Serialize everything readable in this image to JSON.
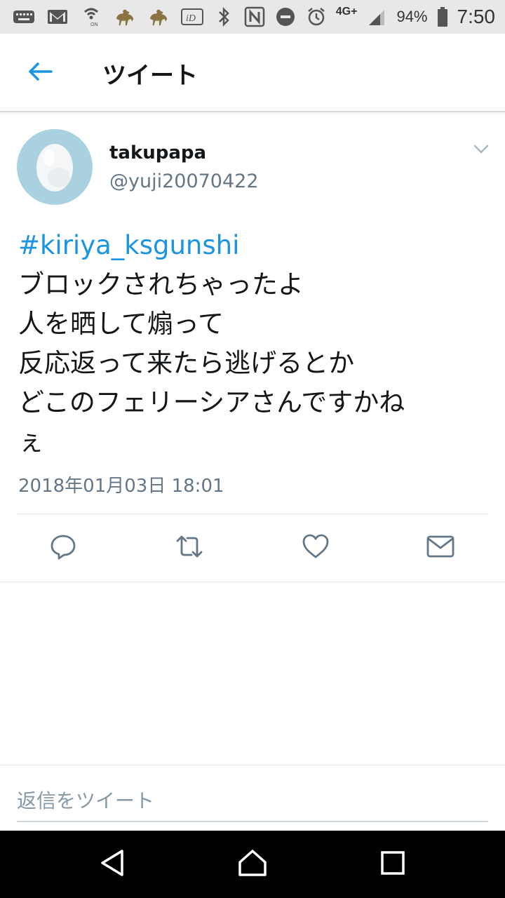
{
  "status_bar": {
    "icons_left": [
      "keyboard-icon",
      "gmail-icon",
      "wifi-calling-icon",
      "horse-racing-icon",
      "horse-racing-icon",
      "id-icon"
    ],
    "icons_right": [
      "bluetooth-icon",
      "nfc-icon",
      "do-not-disturb-icon",
      "alarm-icon",
      "signal-icon",
      "battery-icon"
    ],
    "network": "4G+",
    "battery": "94%",
    "time": "7:50"
  },
  "header": {
    "title": "ツイート"
  },
  "tweet": {
    "display_name": "takupapa",
    "handle": "@yuji20070422",
    "hashtag": "#kiriya_ksgunshi",
    "lines": [
      "ブロックされちゃったよ",
      "人を晒して煽って",
      "反応返って来たら逃げるとか",
      "どこのフェリーシアさんですかね",
      "ぇ"
    ],
    "timestamp": "2018年01月03日 18:01"
  },
  "reply": {
    "placeholder": "返信をツイート"
  },
  "colors": {
    "accent": "#1b95e0",
    "secondary_text": "#657786",
    "icon_gray": "#657786",
    "avatar_bg": "#a9d1df"
  }
}
